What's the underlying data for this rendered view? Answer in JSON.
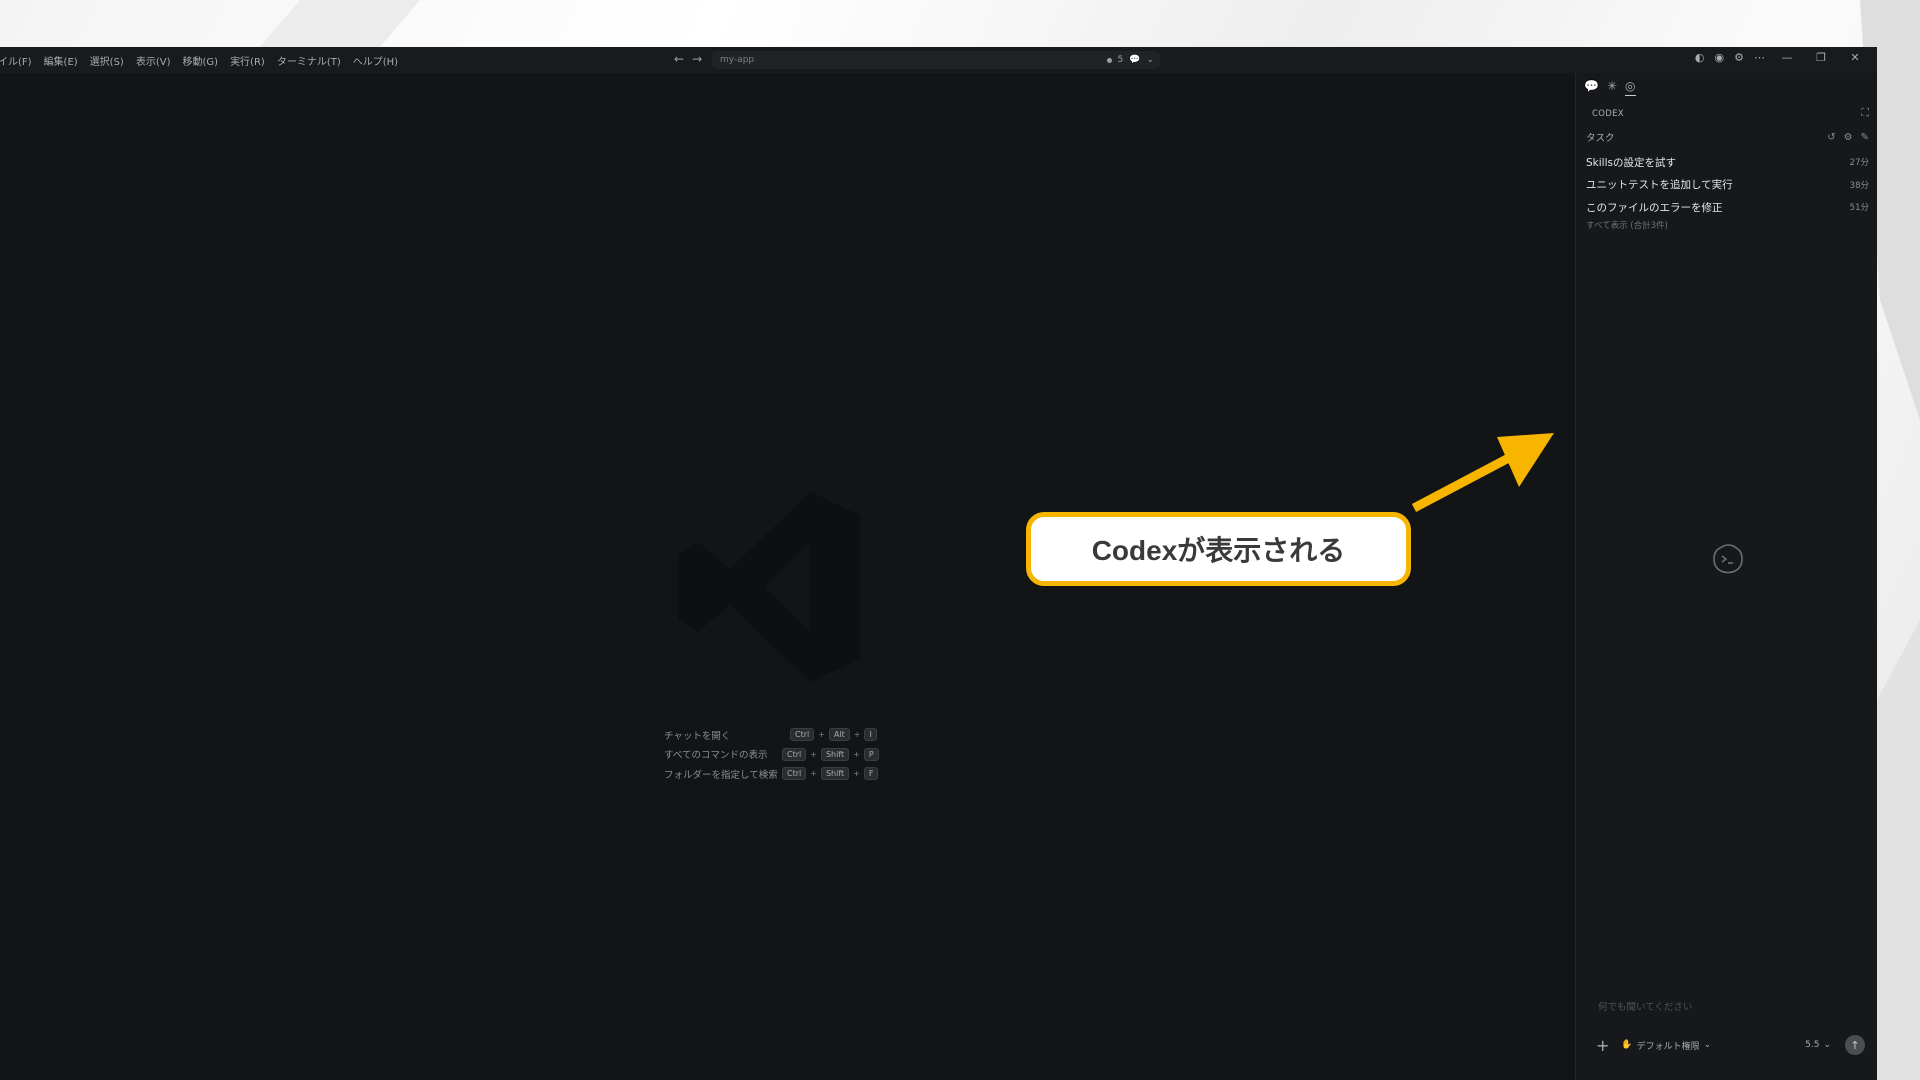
{
  "menu": [
    "イル(F)",
    "編集(E)",
    "選択(S)",
    "表示(V)",
    "移動(G)",
    "実行(R)",
    "ターミナル(T)",
    "ヘルプ(H)"
  ],
  "command_center": {
    "label": "my-app",
    "count": "5"
  },
  "shortcuts": [
    {
      "label": "チャットを開く",
      "keys": [
        "Ctrl",
        "Alt",
        "I"
      ]
    },
    {
      "label": "すべてのコマンドの表示",
      "keys": [
        "Ctrl",
        "Shift",
        "P"
      ]
    },
    {
      "label": "フォルダーを指定して検索",
      "keys": [
        "Ctrl",
        "Shift",
        "F"
      ]
    }
  ],
  "panel": {
    "title": "CODEX",
    "tasks_header": "タスク",
    "tasks": [
      {
        "name": "Skillsの設定を試す",
        "time": "27分"
      },
      {
        "name": "ユニットテストを追加して実行",
        "time": "38分"
      },
      {
        "name": "このファイルのエラーを修正",
        "time": "51分"
      }
    ],
    "show_all": "すべて表示 (合計3件)",
    "input_placeholder": "何でも聞いてください",
    "permission": "デフォルト権限",
    "model": "5.5"
  },
  "callout": {
    "text": "Codexが表示される",
    "border_color": "#f7b500"
  }
}
